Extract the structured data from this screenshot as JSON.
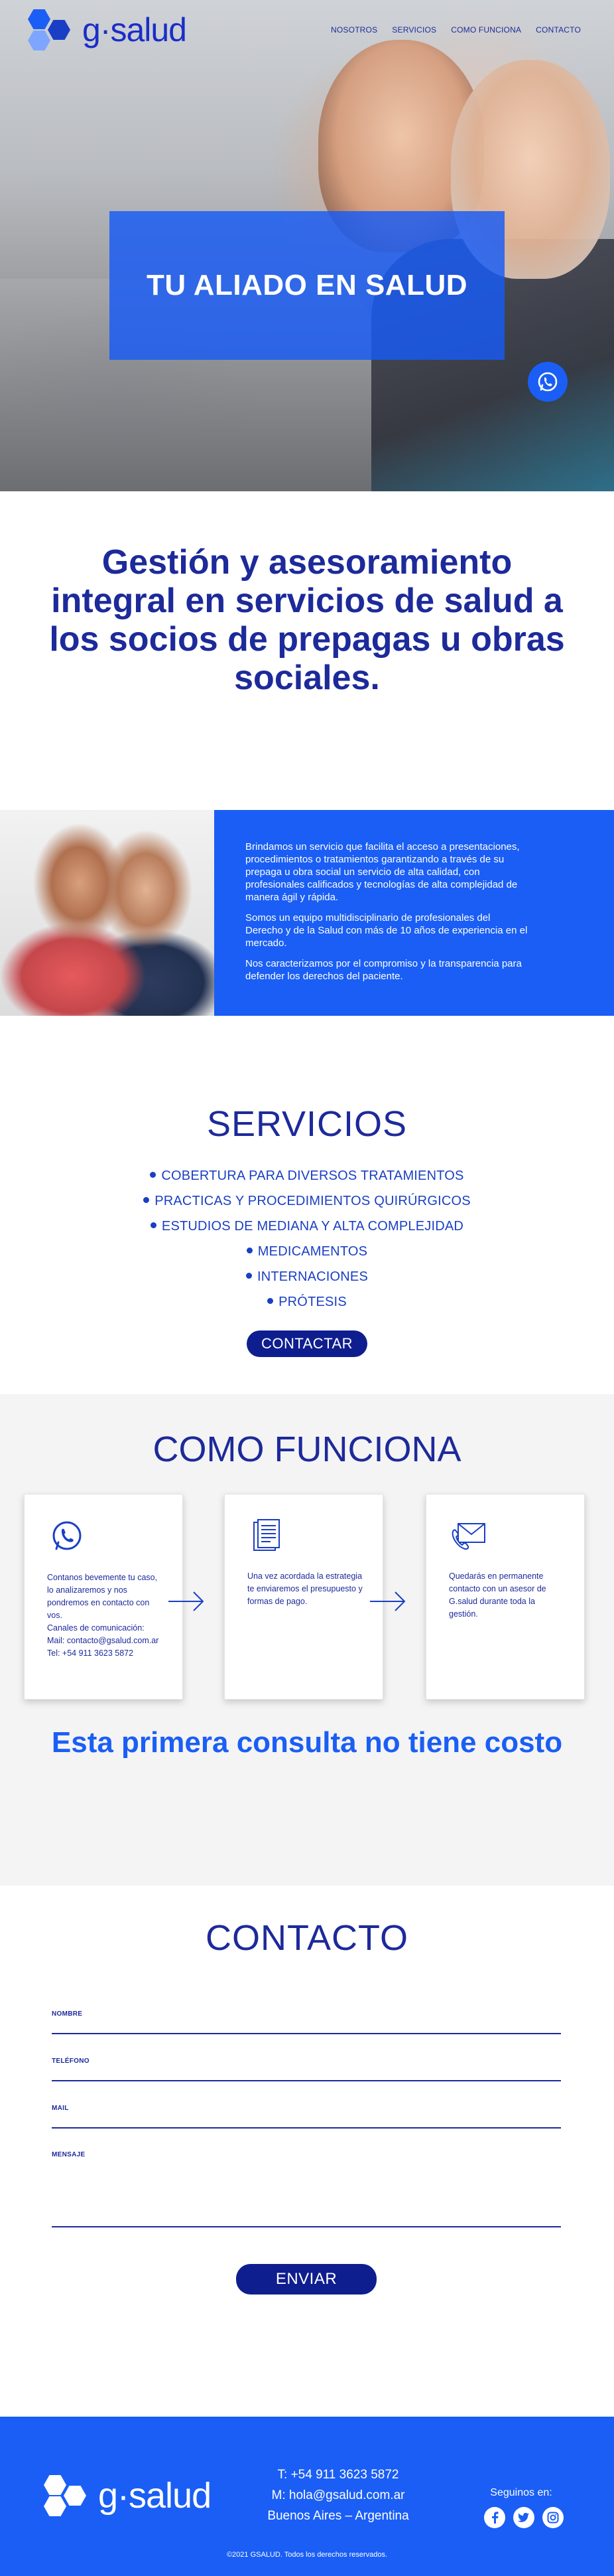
{
  "brand": {
    "name": "g·salud",
    "colors": {
      "primary": "#1a5ef5",
      "navy": "#1d2a9a",
      "light_bg": "#f4f4f4"
    }
  },
  "nav": {
    "items": [
      "NOSOTROS",
      "SERVICIOS",
      "COMO FUNCIONA",
      "CONTACTO"
    ]
  },
  "hero": {
    "title": "TU ALIADO EN SALUD",
    "whatsapp_icon": "whatsapp-icon"
  },
  "intro": {
    "heading": "Gestión y asesoramiento integral en servicios de salud a los socios de prepagas u obras sociales."
  },
  "about": {
    "paragraphs": [
      "Brindamos un servicio que facilita el acceso a presentaciones, procedimientos o tratamientos garantizando a través de su prepaga u obra social un servicio de alta calidad, con profesionales calificados y tecnologías de alta complejidad de manera ágil y rápida.",
      "Somos un equipo multidisciplinario de profesionales del Derecho y de la Salud con más de 10 años de experiencia en el mercado.",
      "Nos caracterizamos por el compromiso y la transparencia para defender los derechos del paciente."
    ]
  },
  "servicios": {
    "title": "SERVICIOS",
    "items": [
      "COBERTURA PARA DIVERSOS TRATAMIENTOS",
      "PRACTICAS Y PROCEDIMIENTOS QUIRÚRGICOS",
      "ESTUDIOS DE MEDIANA Y ALTA COMPLEJIDAD",
      "MEDICAMENTOS",
      "INTERNACIONES",
      "PRÓTESIS"
    ],
    "button": "CONTACTAR"
  },
  "como": {
    "title": "COMO FUNCIONA",
    "cards": [
      {
        "icon": "whatsapp-icon",
        "lines": [
          "Contanos bevemente tu caso, lo analizaremos y nos pondremos en contacto con vos.",
          "Canales de comunicación:",
          "Mail: contacto@gsalud.com.ar",
          "Tel: +54 911 3623 5872"
        ]
      },
      {
        "icon": "document-icon",
        "lines": [
          "Una vez acordada la estrategia te enviaremos el presupuesto y formas de pago."
        ]
      },
      {
        "icon": "mail-phone-icon",
        "lines": [
          "Quedarás en permanente contacto con un asesor de G.salud durante toda la gestión."
        ]
      }
    ],
    "free_text": "Esta primera consulta no tiene costo"
  },
  "contacto": {
    "title": "CONTACTO",
    "fields": {
      "nombre": {
        "label": "NOMBRE",
        "value": ""
      },
      "telefono": {
        "label": "TELÉFONO",
        "value": ""
      },
      "mail": {
        "label": "MAIL",
        "value": ""
      },
      "mensaje": {
        "label": "MENSAJE",
        "value": ""
      }
    },
    "button": "ENVIAR"
  },
  "footer": {
    "phone": "T: +54 911 3623 5872",
    "email": "M: hola@gsalud.com.ar",
    "location": "Buenos Aires – Argentina",
    "follow": "Seguinos en:",
    "socials": [
      "facebook-icon",
      "twitter-icon",
      "instagram-icon"
    ],
    "copyright": "©2021 GSALUD. Todos los derechos reservados."
  }
}
